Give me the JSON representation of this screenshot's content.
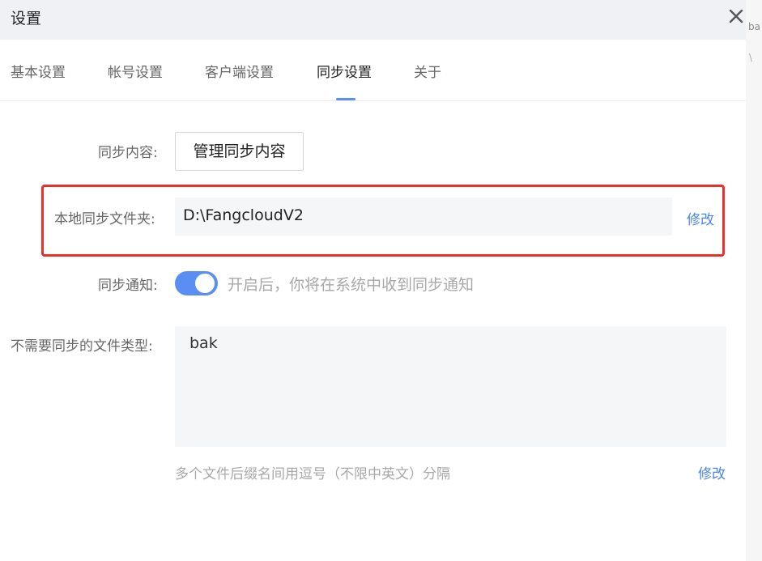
{
  "window": {
    "title": "设置",
    "close_icon": "close-icon"
  },
  "side_strip": {
    "text": "ba",
    "mark": "\\"
  },
  "tabs": [
    {
      "label": "基本设置",
      "active": false
    },
    {
      "label": "帐号设置",
      "active": false
    },
    {
      "label": "客户端设置",
      "active": false
    },
    {
      "label": "同步设置",
      "active": true
    },
    {
      "label": "关于",
      "active": false
    }
  ],
  "sync_content": {
    "label": "同步内容:",
    "button_label": "管理同步内容"
  },
  "local_folder": {
    "label": "本地同步文件夹:",
    "path": "D:\\FangcloudV2",
    "edit_label": "修改"
  },
  "sync_notice": {
    "label": "同步通知:",
    "enabled": true,
    "description": "开启后，你将在系统中收到同步通知"
  },
  "excluded_types": {
    "label": "不需要同步的文件类型:",
    "value": "bak",
    "hint": "多个文件后缀名间用逗号（不限中英文）分隔",
    "edit_label": "修改"
  },
  "colors": {
    "accent": "#5b8ef2",
    "link": "#4a86e8",
    "highlight_border": "#e8312a"
  }
}
